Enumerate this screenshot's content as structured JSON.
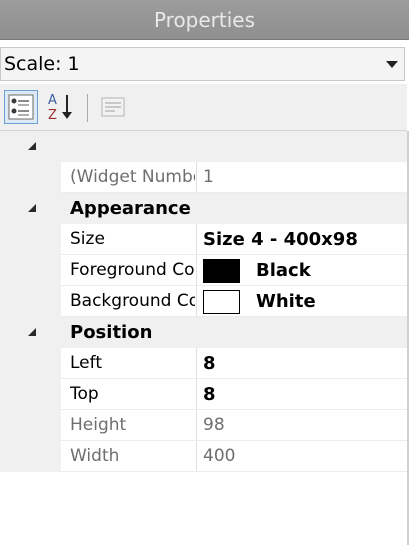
{
  "panel": {
    "title": "Properties",
    "scale_select": {
      "value": "Scale: 1"
    }
  },
  "toolbar": {
    "buttons": [
      {
        "name": "categorized",
        "icon": "categorized-icon",
        "active": true
      },
      {
        "name": "alphabetical",
        "icon": "sort-az-icon",
        "active": false
      },
      {
        "name": "property-pages",
        "icon": "property-pages-icon",
        "active": false,
        "disabled": true
      }
    ]
  },
  "grid": {
    "misc": {
      "category": "",
      "widget_number": {
        "name": "(Widget Number)",
        "value": "1"
      }
    },
    "appearance": {
      "category": "Appearance",
      "size": {
        "name": "Size",
        "value": "Size 4 - 400x98"
      },
      "foreground": {
        "name": "Foreground Color",
        "value": "Black",
        "color": "#000000"
      },
      "background": {
        "name": "Background Color",
        "value": "White",
        "color": "#ffffff"
      }
    },
    "position": {
      "category": "Position",
      "left": {
        "name": "Left",
        "value": "8"
      },
      "top": {
        "name": "Top",
        "value": "8"
      },
      "height": {
        "name": "Height",
        "value": "98"
      },
      "width": {
        "name": "Width",
        "value": "400"
      }
    }
  },
  "colors": {
    "titlebar": "#969696",
    "gutter": "#f0f0f0",
    "readonly_text": "#6e6e6e",
    "selected_button": "#dce9f7"
  }
}
